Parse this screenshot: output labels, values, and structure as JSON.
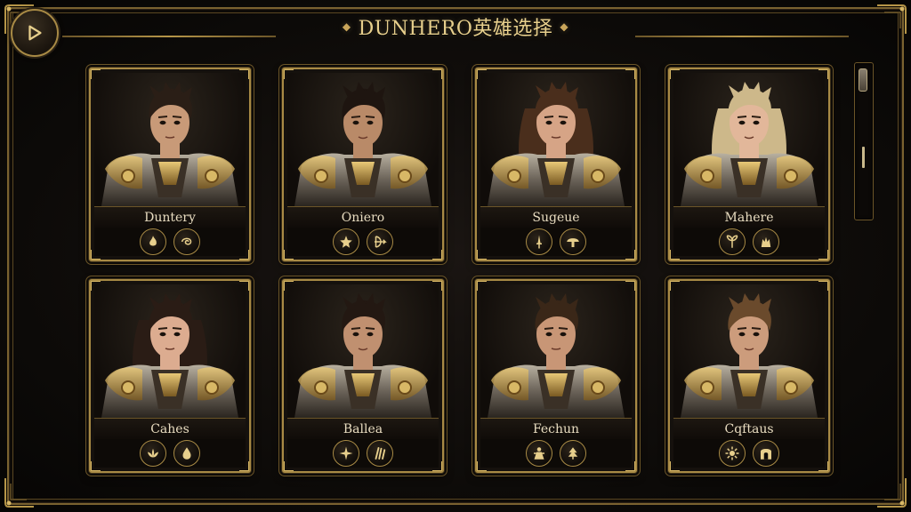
{
  "header": {
    "title": "DUNHERO英雄选择",
    "left_ornament": "◆",
    "right_ornament": "◆"
  },
  "colors": {
    "gold": "#a88a45",
    "gold_light": "#e7cf8c",
    "background": "#0a0807",
    "name_text": "#e8dcc0"
  },
  "heroes": [
    {
      "name": "Duntery",
      "hair": "#2a1e16",
      "skin": "#c89a78",
      "skills": [
        "flame-icon",
        "swirl-icon"
      ]
    },
    {
      "name": "Oniero",
      "hair": "#1e1510",
      "skin": "#b98a68",
      "skills": [
        "star-icon",
        "bow-icon"
      ]
    },
    {
      "name": "Sugeue",
      "hair": "#4a2e1c",
      "skin": "#d6a486",
      "skills": [
        "dagger-icon",
        "mushroom-icon"
      ]
    },
    {
      "name": "Mahere",
      "hair": "#cdb88a",
      "skin": "#e2b79a",
      "skills": [
        "leaf-icon",
        "wolf-icon"
      ]
    },
    {
      "name": "Cahes",
      "hair": "#2a1c15",
      "skin": "#dcac90",
      "skills": [
        "lotus-icon",
        "drop-icon"
      ]
    },
    {
      "name": "Ballea",
      "hair": "#231812",
      "skin": "#c09070",
      "skills": [
        "shuriken-icon",
        "claw-icon"
      ]
    },
    {
      "name": "Fechun",
      "hair": "#3a2718",
      "skin": "#c89676",
      "skills": [
        "figure-icon",
        "tree-icon"
      ]
    },
    {
      "name": "Cqftaus",
      "hair": "#6a4a2c",
      "skin": "#cc9c7c",
      "skills": [
        "sun-icon",
        "gate-icon"
      ]
    }
  ]
}
